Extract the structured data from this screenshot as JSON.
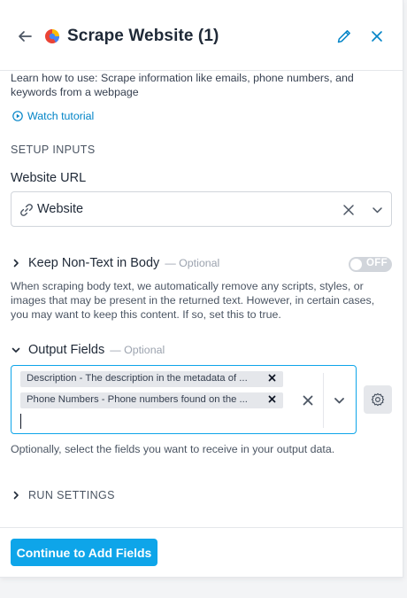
{
  "header": {
    "title": "Scrape Website (1)"
  },
  "learn": {
    "prefix": "Learn how to use: ",
    "text": "Scrape information like emails, phone numbers, and keywords from a webpage",
    "watch_label": "Watch tutorial"
  },
  "setup": {
    "section_title": "SETUP INPUTS",
    "website_url": {
      "label": "Website URL",
      "value": "Website"
    },
    "keep_non_text": {
      "label": "Keep Non-Text in Body",
      "optional": "— Optional",
      "toggle_state": "OFF",
      "description": "When scraping body text, we automatically remove any scripts, styles, or images that may be present in the returned text. However, in certain cases, you may want to keep this content. If so, set this to true."
    },
    "output_fields": {
      "label": "Output Fields",
      "optional": "— Optional",
      "chips": [
        "Description - The description in the metadata of ...",
        "Phone Numbers - Phone numbers found on the ..."
      ],
      "description": "Optionally, select the fields you want to receive in your output data."
    }
  },
  "run_settings": {
    "label": "RUN SETTINGS"
  },
  "footer": {
    "primary_label": "Continue to Add Fields"
  },
  "colors": {
    "accent": "#0ea5e9",
    "link": "#0284c7",
    "brand_logo": [
      "#ea4335",
      "#fbbc05",
      "#4285f4"
    ]
  },
  "icons": {
    "back": "arrow-left-icon",
    "edit": "pencil-icon",
    "close": "close-icon",
    "watch": "play-circle-icon",
    "link": "link-icon",
    "gear": "gear-icon"
  }
}
